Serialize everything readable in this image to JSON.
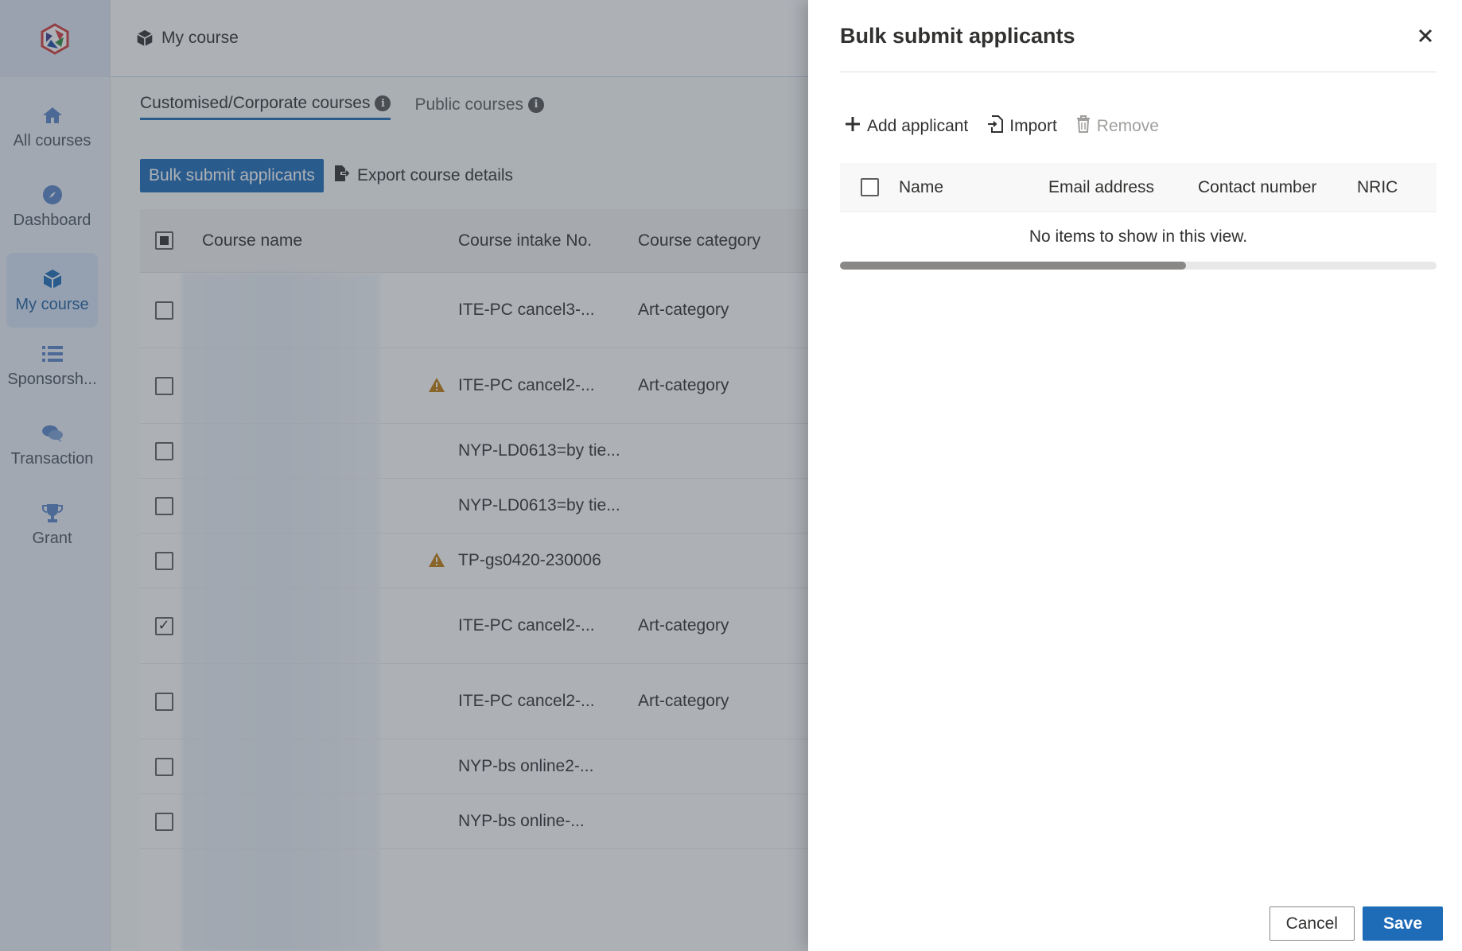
{
  "sidebar": {
    "items": [
      {
        "label": "All courses",
        "icon": "home-icon"
      },
      {
        "label": "Dashboard",
        "icon": "compass-icon"
      },
      {
        "label": "My course",
        "icon": "cube-icon",
        "active": true
      },
      {
        "label": "Sponsorsh...",
        "icon": "list-icon"
      },
      {
        "label": "Transaction",
        "icon": "chat-icon"
      },
      {
        "label": "Grant",
        "icon": "trophy-icon"
      }
    ]
  },
  "header": {
    "title": "My course"
  },
  "tabs": [
    {
      "label": "Customised/Corporate courses",
      "active": true
    },
    {
      "label": "Public courses",
      "active": false
    }
  ],
  "actions": {
    "bulk_submit": "Bulk submit applicants",
    "export": "Export course details"
  },
  "grid": {
    "columns": [
      "Course name",
      "Course intake No.",
      "Course category"
    ],
    "rows": [
      {
        "intake": "ITE-PC cancel3-...",
        "category": "Art-category",
        "warning": false,
        "checked": false
      },
      {
        "intake": "ITE-PC cancel2-...",
        "category": "Art-category",
        "warning": true,
        "checked": false
      },
      {
        "intake": "NYP-LD0613=by tie...",
        "category": "",
        "warning": false,
        "checked": false
      },
      {
        "intake": "NYP-LD0613=by tie...",
        "category": "",
        "warning": false,
        "checked": false
      },
      {
        "intake": "TP-gs0420-230006",
        "category": "",
        "warning": true,
        "checked": false
      },
      {
        "intake": "ITE-PC cancel2-...",
        "category": "Art-category",
        "warning": false,
        "checked": true
      },
      {
        "intake": "ITE-PC cancel2-...",
        "category": "Art-category",
        "warning": false,
        "checked": false
      },
      {
        "intake": "NYP-bs online2-...",
        "category": "",
        "warning": false,
        "checked": false
      },
      {
        "intake": "NYP-bs online-...",
        "category": "",
        "warning": false,
        "checked": false
      }
    ]
  },
  "panel": {
    "title": "Bulk submit applicants",
    "commands": {
      "add": "Add applicant",
      "import": "Import",
      "remove": "Remove"
    },
    "columns": [
      "Name",
      "Email address",
      "Contact number",
      "NRIC"
    ],
    "empty_message": "No items to show in this view.",
    "cancel_label": "Cancel",
    "save_label": "Save",
    "scroll_fraction": 0.58
  },
  "colors": {
    "accent": "#1e6bb8",
    "warning": "#c27c0e"
  }
}
